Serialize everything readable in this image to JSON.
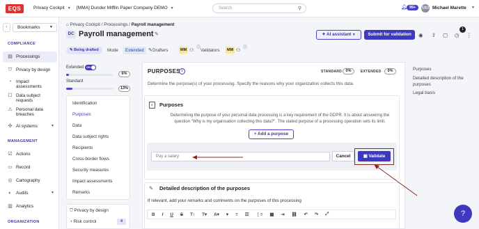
{
  "topbar": {
    "logo": "EQS",
    "workspace": "Privacy Cockpit",
    "company": "[MMA] Dunder Mifflin Paper Company DEMO",
    "search_placeholder": "Search",
    "notifications": "99+",
    "user_initials": "MM",
    "user_name": "Michael Marette"
  },
  "sidebar": {
    "bookmarks": "Bookmarks",
    "compliance_heading": "COMPLIANCE",
    "compliance_items": [
      "Processings",
      "Privacy by design",
      "Impact assessments",
      "Data subject requests",
      "Personal data breaches",
      "AI systems"
    ],
    "management_heading": "MANAGEMENT",
    "management_items": [
      "Actions",
      "Record",
      "Cartography",
      "Audits",
      "Analytics"
    ],
    "organization_heading": "ORGANIZATION"
  },
  "breadcrumb": {
    "root": "Privacy Cockpit",
    "sep": "/",
    "mid": "Processings",
    "current": "Payroll management"
  },
  "header": {
    "badge": "DC",
    "title": "Payroll management",
    "ai_button": "AI assistant",
    "submit_button": "Submit for validation",
    "notif_count": "1"
  },
  "status": {
    "state": "Being drafted",
    "mode_label": "Mode",
    "mode_value": "Extended",
    "drafters_label": "Drafters",
    "drafter_initials": "MM",
    "validators_label": "Validators",
    "validator_initials": "MM"
  },
  "progress": {
    "extended_label": "Extended",
    "toggle_text": "ON",
    "extended_pct": "6%",
    "extended_value": 6,
    "standard_label": "Standard",
    "standard_pct": "13%",
    "standard_value": 13
  },
  "sections": [
    "Identification",
    "Purposes",
    "Data",
    "Data subject rights",
    "Recipients",
    "Cross-border flows",
    "Security measures",
    "Impact assessments",
    "Remarks"
  ],
  "sections2": {
    "privacy_by_design": "Privacy by design",
    "risk_control": "Risk control",
    "risk_count": "4"
  },
  "main": {
    "title": "PURPOSES",
    "standard_label": "STANDARD",
    "standard_pct": "0%",
    "extended_label": "EXTENDED",
    "extended_pct": "0%",
    "description": "Determine the purpose(s) of your processing. Specify the reasons why your organization collects this data.",
    "card_title": "Purposes",
    "card_body": "Determining the purpose of your personal data processing is a key requirement of the GDPR. It is about answering the question \"Why is my organisation collecting this data?\". The stated purpose of a processing operation sets its limit.",
    "add_button": "Add a purpose",
    "input_value": "Pay a salary",
    "cancel_button": "Cancel",
    "validate_button": "Validate",
    "detail_title": "Detailed description of the purposes",
    "detail_desc": "If relevant, add your remarks and comments on the purposes of this processing"
  },
  "outline": [
    "Purposes",
    "Detailed description of the purposes",
    "Legal basis"
  ],
  "colors": {
    "accent": "#3d3ac0",
    "highlight": "#8a2a1c",
    "logo": "#e0312f"
  }
}
